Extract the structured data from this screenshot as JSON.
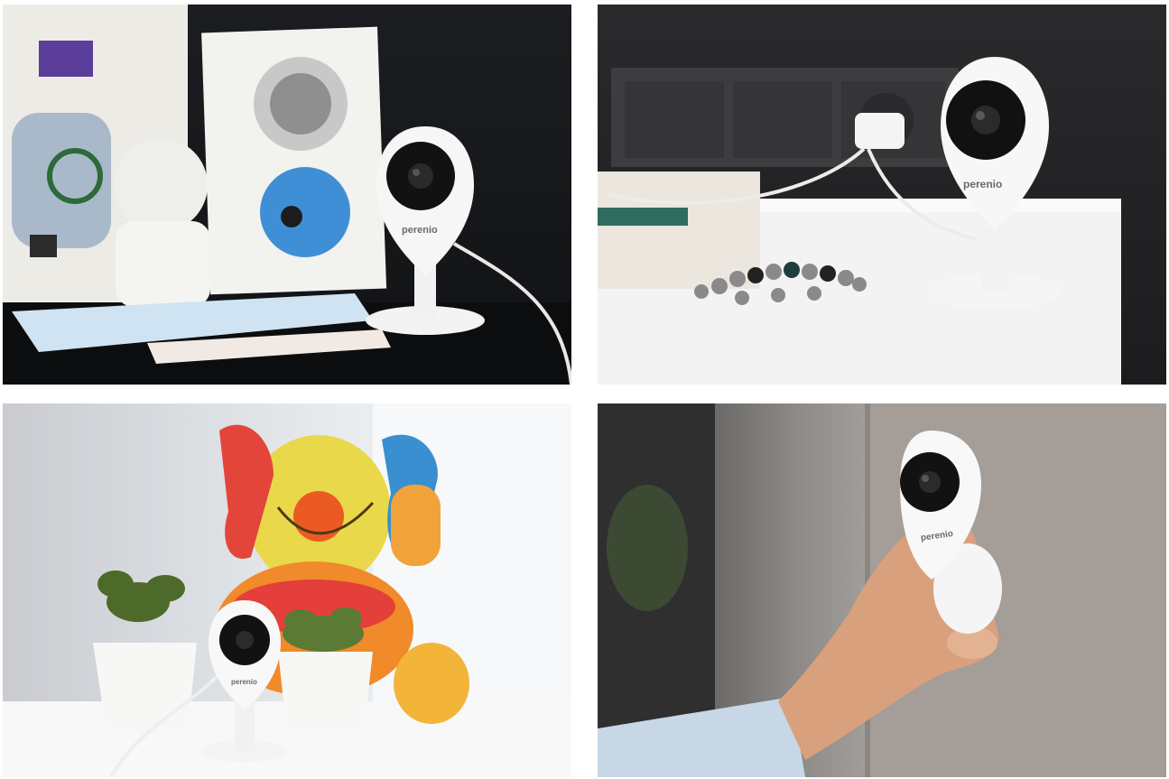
{
  "photos": [
    {
      "scene": "desk-with-drawings",
      "brand_mark": "perenio"
    },
    {
      "scene": "white-dresser",
      "brand_mark": "perenio"
    },
    {
      "scene": "plush-toy-and-plants",
      "brand_mark": "perenio"
    },
    {
      "scene": "wall-mount-hand",
      "brand_mark": "perenio"
    }
  ]
}
